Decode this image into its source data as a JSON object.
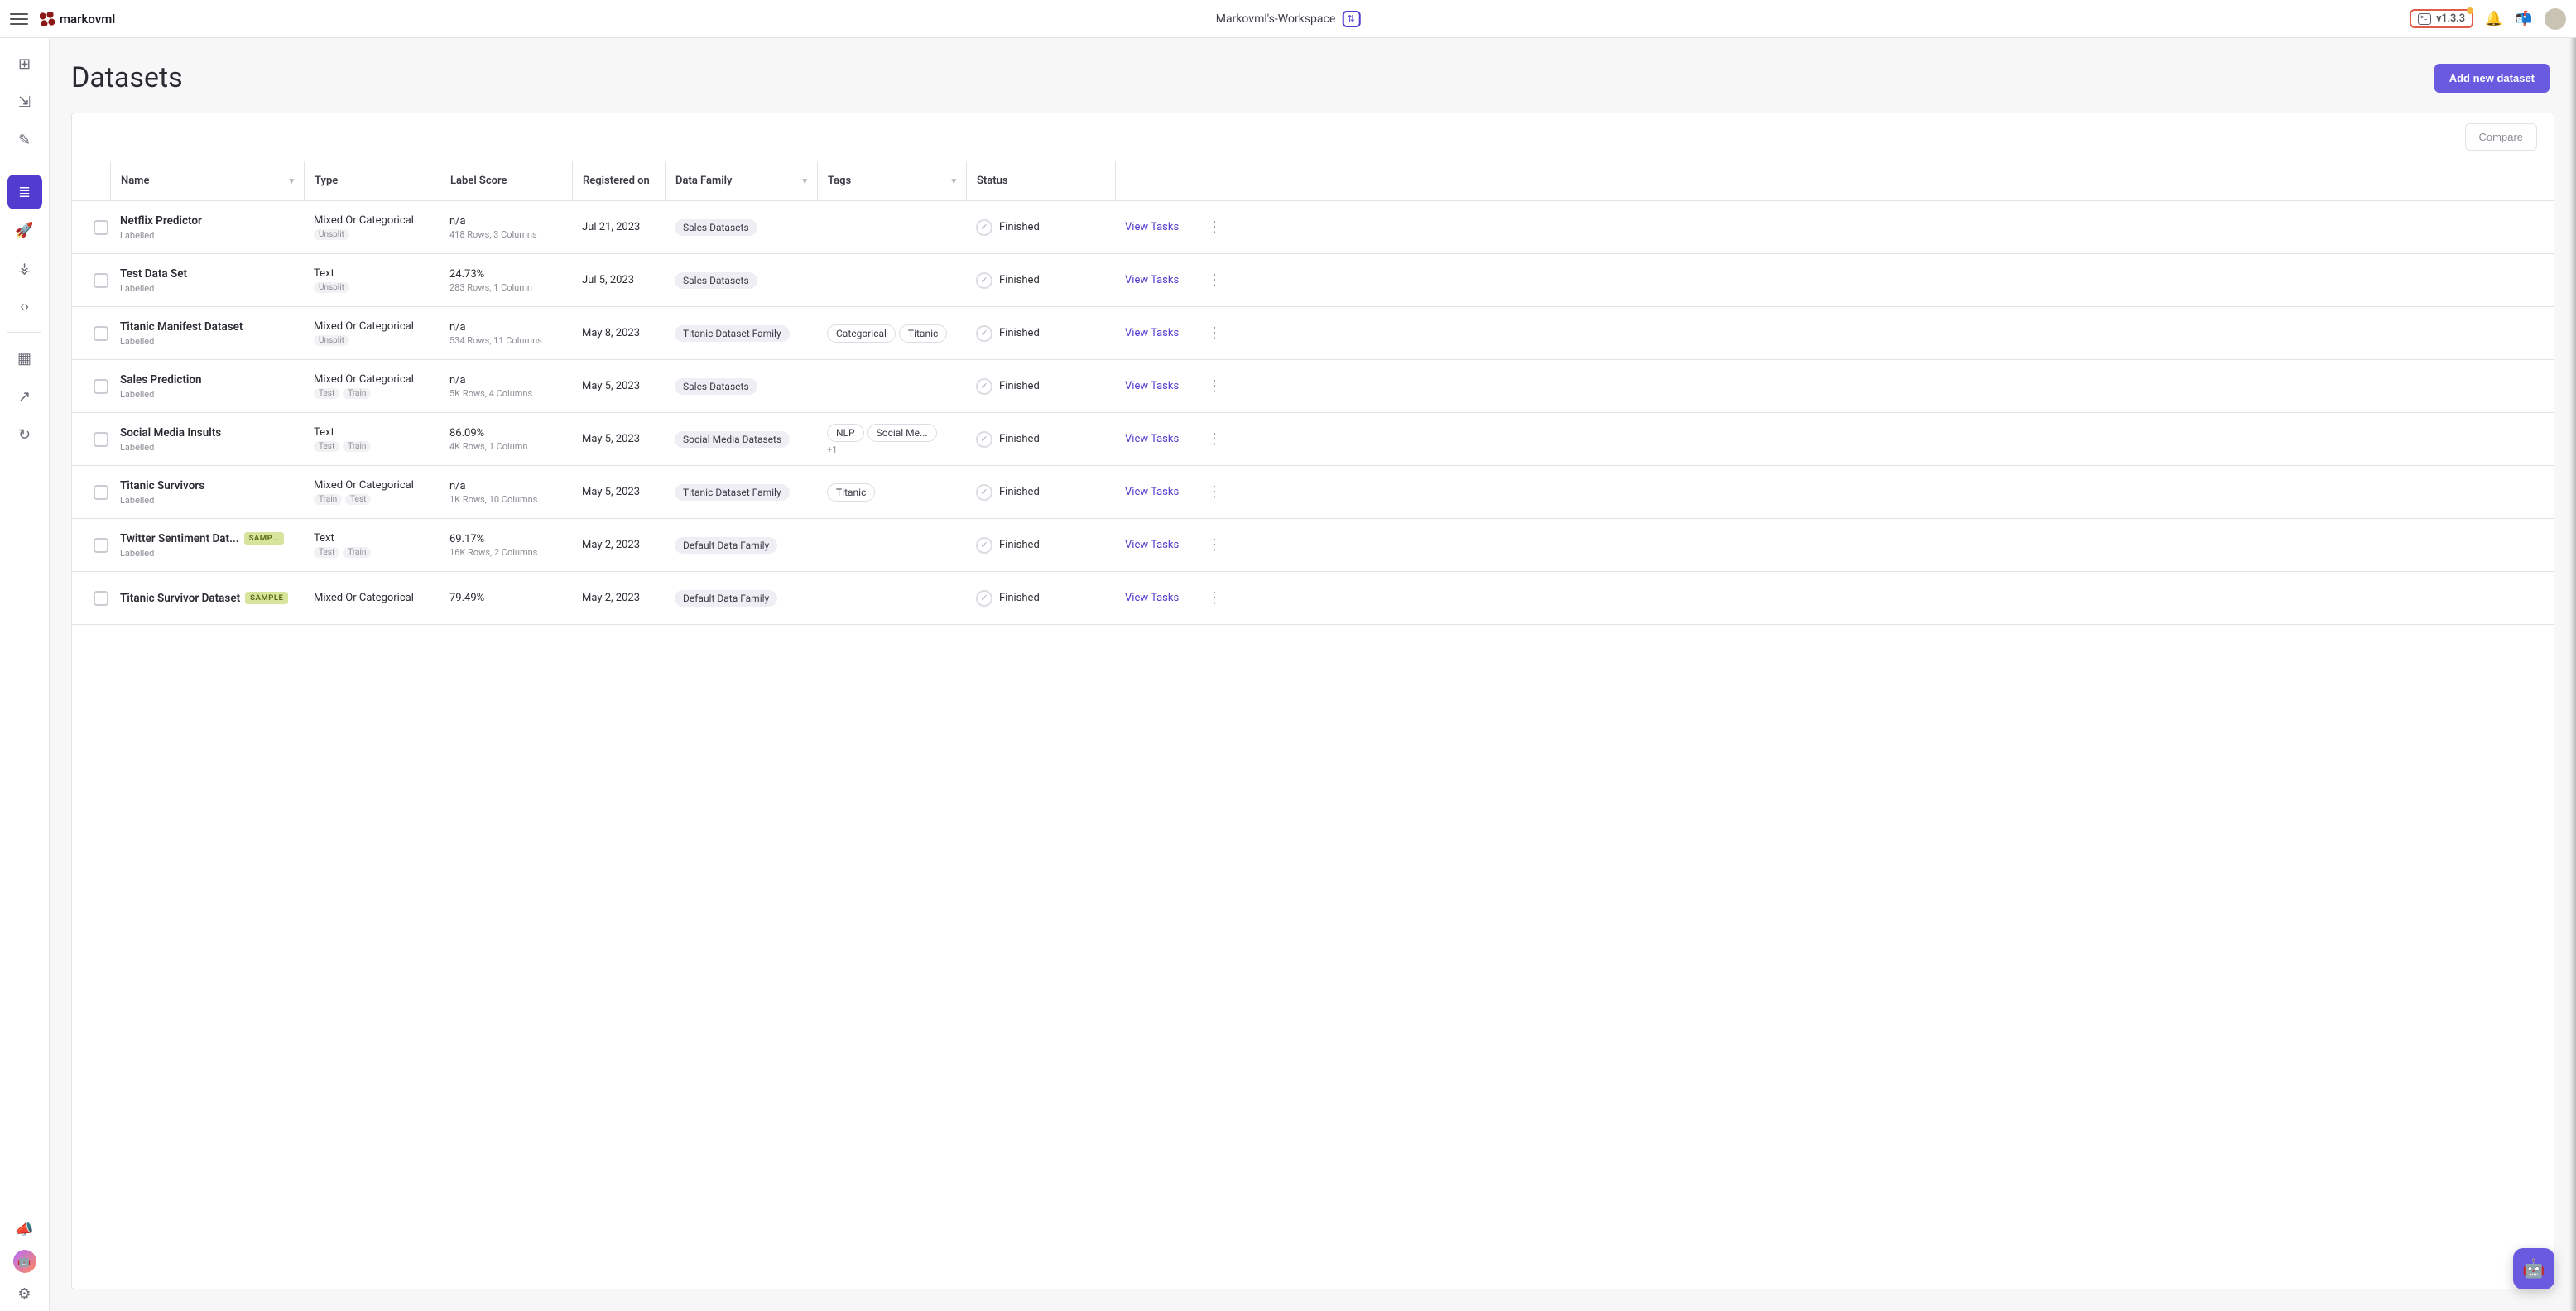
{
  "header": {
    "workspace": "Markovml's-Workspace",
    "version": "v1.3.3",
    "logo_text": "markovml"
  },
  "page": {
    "title": "Datasets",
    "add_button": "Add new dataset",
    "compare_button": "Compare"
  },
  "sidebar": {
    "items": [
      {
        "id": "dashboard",
        "glyph": "⊞"
      },
      {
        "id": "import",
        "glyph": "⇲"
      },
      {
        "id": "edit",
        "glyph": "✎"
      },
      {
        "id": "datasets",
        "glyph": "≣",
        "active": true
      },
      {
        "id": "launch",
        "glyph": "🚀"
      },
      {
        "id": "graph",
        "glyph": "⚶"
      },
      {
        "id": "code",
        "glyph": "‹›"
      },
      {
        "id": "apps",
        "glyph": "▦"
      },
      {
        "id": "analytics",
        "glyph": "↗"
      },
      {
        "id": "history",
        "glyph": "↻"
      }
    ],
    "bottom": [
      {
        "id": "announce",
        "glyph": "📣"
      },
      {
        "id": "settings",
        "glyph": "⚙"
      }
    ]
  },
  "table": {
    "columns": [
      "Name",
      "Type",
      "Label Score",
      "Registered on",
      "Data Family",
      "Tags",
      "Status"
    ],
    "filterable": [
      "Name",
      "Data Family",
      "Tags"
    ],
    "view_tasks_label": "View Tasks",
    "rows": [
      {
        "name": "Netflix Predictor",
        "label": "Labelled",
        "type": "Mixed Or Categorical",
        "type_sub": [
          "Unsplit"
        ],
        "score": "n/a",
        "score_sub": "418 Rows, 3 Columns",
        "registered": "Jul 21, 2023",
        "family": "Sales Datasets",
        "tags": [],
        "tags_more": "",
        "status": "Finished",
        "sample": false
      },
      {
        "name": "Test Data Set",
        "label": "Labelled",
        "type": "Text",
        "type_sub": [
          "Unsplit"
        ],
        "score": "24.73%",
        "score_sub": "283 Rows, 1 Column",
        "registered": "Jul 5, 2023",
        "family": "Sales Datasets",
        "tags": [],
        "tags_more": "",
        "status": "Finished",
        "sample": false
      },
      {
        "name": "Titanic Manifest Dataset",
        "label": "Labelled",
        "type": "Mixed Or Categorical",
        "type_sub": [
          "Unsplit"
        ],
        "score": "n/a",
        "score_sub": "534 Rows, 11 Columns",
        "registered": "May 8, 2023",
        "family": "Titanic Dataset Family",
        "tags": [
          "Categorical",
          "Titanic"
        ],
        "tags_more": "",
        "status": "Finished",
        "sample": false
      },
      {
        "name": "Sales Prediction",
        "label": "Labelled",
        "type": "Mixed Or Categorical",
        "type_sub": [
          "Test",
          "Train"
        ],
        "score": "n/a",
        "score_sub": "5K Rows, 4 Columns",
        "registered": "May 5, 2023",
        "family": "Sales Datasets",
        "tags": [],
        "tags_more": "",
        "status": "Finished",
        "sample": false
      },
      {
        "name": "Social Media Insults",
        "label": "Labelled",
        "type": "Text",
        "type_sub": [
          "Test",
          "Train"
        ],
        "score": "86.09%",
        "score_sub": "4K Rows, 1 Column",
        "registered": "May 5, 2023",
        "family": "Social Media Datasets",
        "tags": [
          "NLP",
          "Social Me..."
        ],
        "tags_more": "+1",
        "status": "Finished",
        "sample": false
      },
      {
        "name": "Titanic Survivors",
        "label": "Labelled",
        "type": "Mixed Or Categorical",
        "type_sub": [
          "Train",
          "Test"
        ],
        "score": "n/a",
        "score_sub": "1K Rows, 10 Columns",
        "registered": "May 5, 2023",
        "family": "Titanic Dataset Family",
        "tags": [
          "Titanic"
        ],
        "tags_more": "",
        "status": "Finished",
        "sample": false
      },
      {
        "name": "Twitter Sentiment Dat...",
        "label": "Labelled",
        "type": "Text",
        "type_sub": [
          "Test",
          "Train"
        ],
        "score": "69.17%",
        "score_sub": "16K Rows, 2 Columns",
        "registered": "May 2, 2023",
        "family": "Default Data Family",
        "tags": [],
        "tags_more": "",
        "status": "Finished",
        "sample": true,
        "sample_label": "SAMP..."
      },
      {
        "name": "Titanic Survivor Dataset",
        "label": "",
        "type": "Mixed Or Categorical",
        "type_sub": [],
        "score": "79.49%",
        "score_sub": "",
        "registered": "May 2, 2023",
        "family": "Default Data Family",
        "tags": [],
        "tags_more": "",
        "status": "Finished",
        "sample": true,
        "sample_label": "SAMPLE"
      }
    ]
  }
}
